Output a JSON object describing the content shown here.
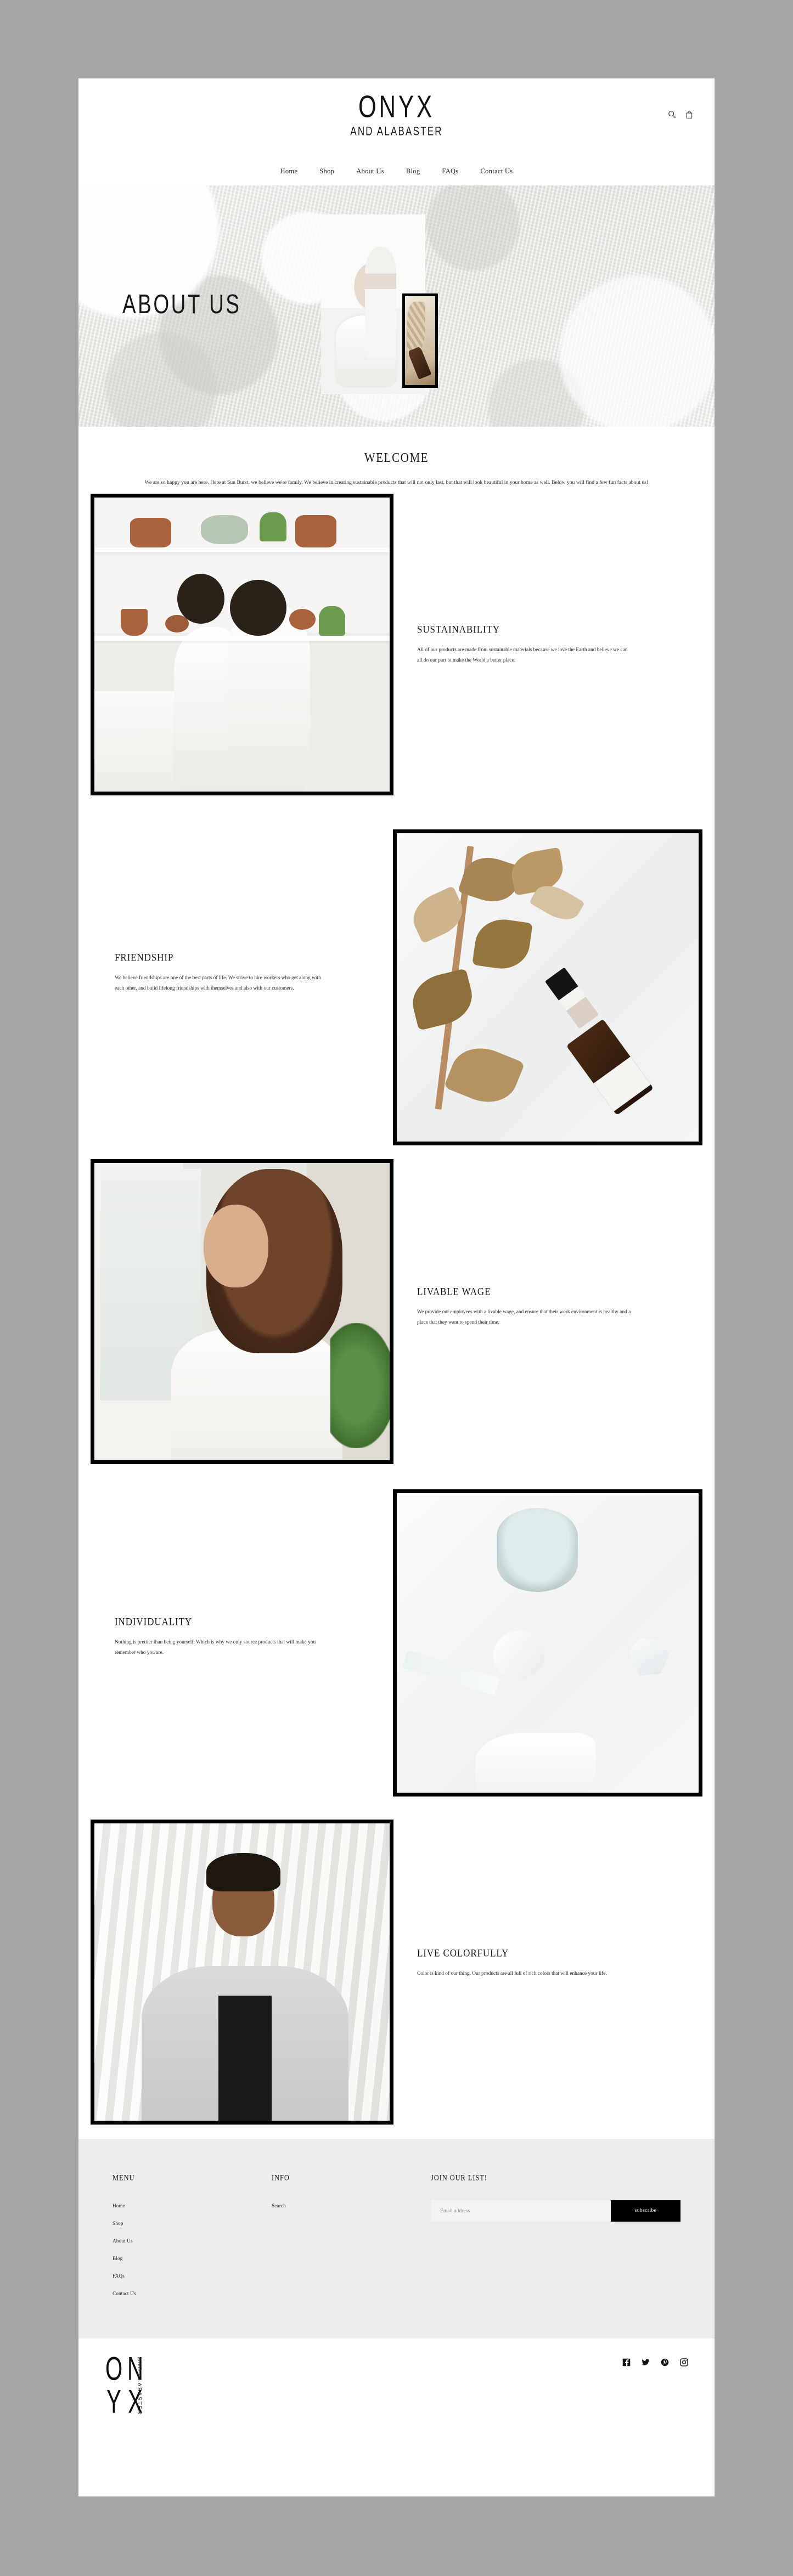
{
  "brand": {
    "name": "ONYX",
    "tagline": "AND ALABASTER",
    "footer_logo_letters": [
      "O",
      "N",
      "Y",
      "X"
    ],
    "footer_logo_vertical": "AND ALABASTER"
  },
  "header": {
    "icons": [
      {
        "name": "search-icon",
        "label": "Search"
      },
      {
        "name": "cart-icon",
        "label": "Cart"
      }
    ],
    "nav": [
      {
        "label": "Home"
      },
      {
        "label": "Shop"
      },
      {
        "label": "About Us"
      },
      {
        "label": "Blog"
      },
      {
        "label": "FAQs"
      },
      {
        "label": "Contact Us"
      }
    ]
  },
  "hero": {
    "title": "ABOUT US",
    "images": [
      {
        "alt": "Woman with hair towel applying skincare beside a bathtub"
      },
      {
        "alt": "Dried palm fronds and amber dropper bottle, framed in black"
      }
    ]
  },
  "welcome": {
    "heading": "WELCOME",
    "body": "We are so happy you are here. Here at Sun Burst, we believe we're family. We believe in creating sustainable products that will not only last, but that will look beautiful in your home as well. Below you will find a few fun facts about us!"
  },
  "features": [
    {
      "title": "SUSTAINABILITY",
      "body": "All of our products are made from sustainable materials because we love the Earth and believe we can all do our part to make the World a better place.",
      "image_alt": "Two women in white robes seated in a white studio with ceramic shelves",
      "image_side": "left"
    },
    {
      "title": "FRIENDSHIP",
      "body": "We believe friendships are one of the best parts of life. We strive to hire workers who get along with each other, and build lifelong friendships with themselves and also with our customers.",
      "image_alt": "Dried eucalyptus branch and amber serum bottle on white marble",
      "image_side": "right"
    },
    {
      "title": "LIVABLE WAGE",
      "body": "We provide our employees with a livable wage, and ensure that their work environment is healthy and a place that they want to spend their time.",
      "image_alt": "Woman with curly hair holding a serum dropper by a window",
      "image_side": "left"
    },
    {
      "title": "INDIVIDUALITY",
      "body": "Nothing is prettier than being yourself. Which is why we only source products that will make you remember who you are.",
      "image_alt": "Glass jar, rose quartz facial roller and gua sha stone on marble",
      "image_side": "right"
    },
    {
      "title": "LIVE COLORFULLY",
      "body": "Color is kind of our thing. Our products are all full of rich colors that will enhance your life.",
      "image_alt": "Smiling woman in a light grey blazer with arms crossed",
      "image_side": "left"
    }
  ],
  "footer": {
    "menu": {
      "heading": "MENU",
      "links": [
        {
          "label": "Home"
        },
        {
          "label": "Shop"
        },
        {
          "label": "About Us"
        },
        {
          "label": "Blog"
        },
        {
          "label": "FAQs"
        },
        {
          "label": "Contact Us"
        }
      ]
    },
    "info": {
      "heading": "INFO",
      "links": [
        {
          "label": "Search"
        }
      ]
    },
    "newsletter": {
      "heading": "JOIN OUR LIST!",
      "email_placeholder": "Email address",
      "email_value": "",
      "submit_label": "subscribe"
    },
    "socials": [
      {
        "name": "facebook-icon",
        "label": "Facebook"
      },
      {
        "name": "twitter-icon",
        "label": "Twitter"
      },
      {
        "name": "pinterest-icon",
        "label": "Pinterest"
      },
      {
        "name": "instagram-icon",
        "label": "Instagram"
      }
    ]
  },
  "colors": {
    "page_background": "#a6a6a6",
    "surface": "#ffffff",
    "footer_background": "#eeedeb",
    "accent": "#000000",
    "input_background": "#f5f4f3",
    "text": "#1a1a1a"
  }
}
